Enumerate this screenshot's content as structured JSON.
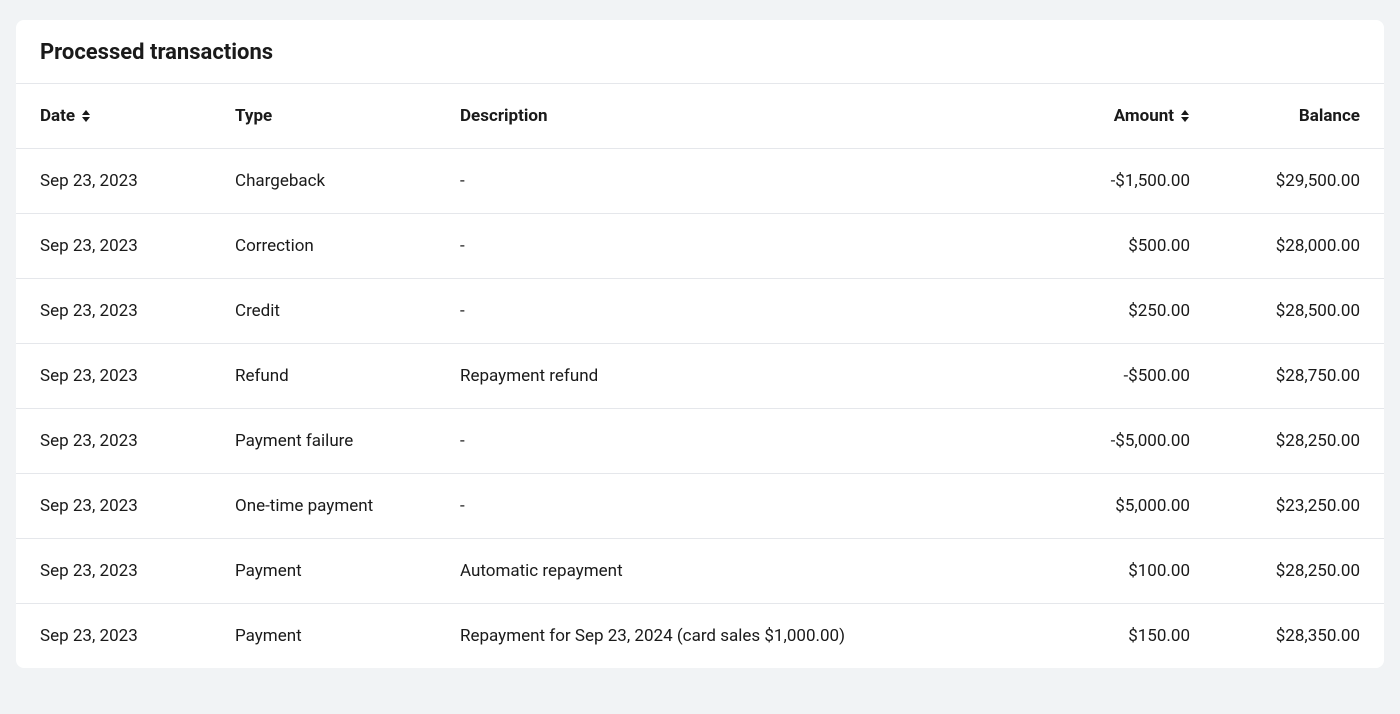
{
  "title": "Processed transactions",
  "columns": {
    "date": "Date",
    "type": "Type",
    "description": "Description",
    "amount": "Amount",
    "balance": "Balance"
  },
  "rows": [
    {
      "date": "Sep 23, 2023",
      "type": "Chargeback",
      "description": "-",
      "amount": "-$1,500.00",
      "balance": "$29,500.00"
    },
    {
      "date": "Sep 23, 2023",
      "type": "Correction",
      "description": "-",
      "amount": "$500.00",
      "balance": "$28,000.00"
    },
    {
      "date": "Sep 23, 2023",
      "type": "Credit",
      "description": "-",
      "amount": "$250.00",
      "balance": "$28,500.00"
    },
    {
      "date": "Sep 23, 2023",
      "type": "Refund",
      "description": "Repayment refund",
      "amount": "-$500.00",
      "balance": "$28,750.00"
    },
    {
      "date": "Sep 23, 2023",
      "type": "Payment failure",
      "description": "-",
      "amount": "-$5,000.00",
      "balance": "$28,250.00"
    },
    {
      "date": "Sep 23, 2023",
      "type": "One-time payment",
      "description": "-",
      "amount": "$5,000.00",
      "balance": "$23,250.00"
    },
    {
      "date": "Sep 23, 2023",
      "type": "Payment",
      "description": "Automatic repayment",
      "amount": "$100.00",
      "balance": "$28,250.00"
    },
    {
      "date": "Sep 23, 2023",
      "type": "Payment",
      "description": "Repayment for Sep 23, 2024 (card sales $1,000.00)",
      "amount": "$150.00",
      "balance": "$28,350.00"
    }
  ]
}
